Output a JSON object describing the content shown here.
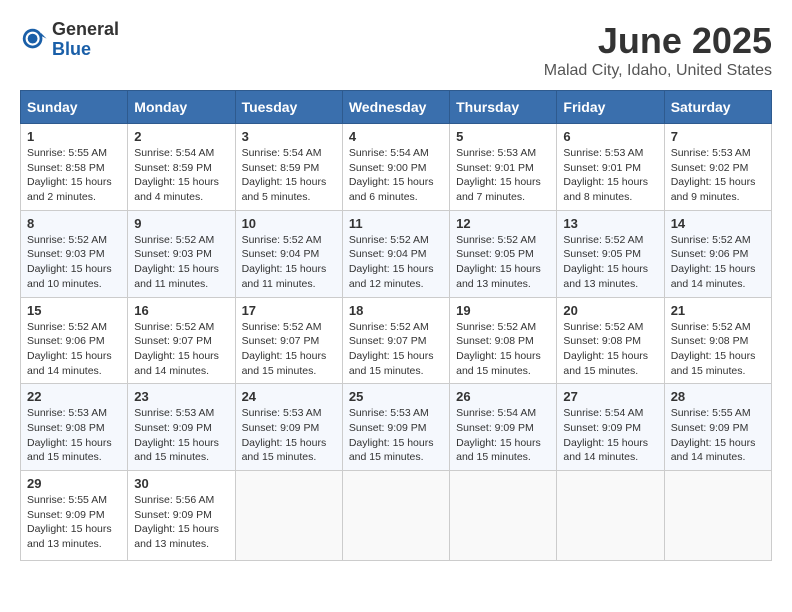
{
  "logo": {
    "general": "General",
    "blue": "Blue"
  },
  "title": "June 2025",
  "subtitle": "Malad City, Idaho, United States",
  "days_of_week": [
    "Sunday",
    "Monday",
    "Tuesday",
    "Wednesday",
    "Thursday",
    "Friday",
    "Saturday"
  ],
  "weeks": [
    [
      {
        "day": "1",
        "sunrise": "5:55 AM",
        "sunset": "8:58 PM",
        "daylight": "15 hours and 2 minutes."
      },
      {
        "day": "2",
        "sunrise": "5:54 AM",
        "sunset": "8:59 PM",
        "daylight": "15 hours and 4 minutes."
      },
      {
        "day": "3",
        "sunrise": "5:54 AM",
        "sunset": "8:59 PM",
        "daylight": "15 hours and 5 minutes."
      },
      {
        "day": "4",
        "sunrise": "5:54 AM",
        "sunset": "9:00 PM",
        "daylight": "15 hours and 6 minutes."
      },
      {
        "day": "5",
        "sunrise": "5:53 AM",
        "sunset": "9:01 PM",
        "daylight": "15 hours and 7 minutes."
      },
      {
        "day": "6",
        "sunrise": "5:53 AM",
        "sunset": "9:01 PM",
        "daylight": "15 hours and 8 minutes."
      },
      {
        "day": "7",
        "sunrise": "5:53 AM",
        "sunset": "9:02 PM",
        "daylight": "15 hours and 9 minutes."
      }
    ],
    [
      {
        "day": "8",
        "sunrise": "5:52 AM",
        "sunset": "9:03 PM",
        "daylight": "15 hours and 10 minutes."
      },
      {
        "day": "9",
        "sunrise": "5:52 AM",
        "sunset": "9:03 PM",
        "daylight": "15 hours and 11 minutes."
      },
      {
        "day": "10",
        "sunrise": "5:52 AM",
        "sunset": "9:04 PM",
        "daylight": "15 hours and 11 minutes."
      },
      {
        "day": "11",
        "sunrise": "5:52 AM",
        "sunset": "9:04 PM",
        "daylight": "15 hours and 12 minutes."
      },
      {
        "day": "12",
        "sunrise": "5:52 AM",
        "sunset": "9:05 PM",
        "daylight": "15 hours and 13 minutes."
      },
      {
        "day": "13",
        "sunrise": "5:52 AM",
        "sunset": "9:05 PM",
        "daylight": "15 hours and 13 minutes."
      },
      {
        "day": "14",
        "sunrise": "5:52 AM",
        "sunset": "9:06 PM",
        "daylight": "15 hours and 14 minutes."
      }
    ],
    [
      {
        "day": "15",
        "sunrise": "5:52 AM",
        "sunset": "9:06 PM",
        "daylight": "15 hours and 14 minutes."
      },
      {
        "day": "16",
        "sunrise": "5:52 AM",
        "sunset": "9:07 PM",
        "daylight": "15 hours and 14 minutes."
      },
      {
        "day": "17",
        "sunrise": "5:52 AM",
        "sunset": "9:07 PM",
        "daylight": "15 hours and 15 minutes."
      },
      {
        "day": "18",
        "sunrise": "5:52 AM",
        "sunset": "9:07 PM",
        "daylight": "15 hours and 15 minutes."
      },
      {
        "day": "19",
        "sunrise": "5:52 AM",
        "sunset": "9:08 PM",
        "daylight": "15 hours and 15 minutes."
      },
      {
        "day": "20",
        "sunrise": "5:52 AM",
        "sunset": "9:08 PM",
        "daylight": "15 hours and 15 minutes."
      },
      {
        "day": "21",
        "sunrise": "5:52 AM",
        "sunset": "9:08 PM",
        "daylight": "15 hours and 15 minutes."
      }
    ],
    [
      {
        "day": "22",
        "sunrise": "5:53 AM",
        "sunset": "9:08 PM",
        "daylight": "15 hours and 15 minutes."
      },
      {
        "day": "23",
        "sunrise": "5:53 AM",
        "sunset": "9:09 PM",
        "daylight": "15 hours and 15 minutes."
      },
      {
        "day": "24",
        "sunrise": "5:53 AM",
        "sunset": "9:09 PM",
        "daylight": "15 hours and 15 minutes."
      },
      {
        "day": "25",
        "sunrise": "5:53 AM",
        "sunset": "9:09 PM",
        "daylight": "15 hours and 15 minutes."
      },
      {
        "day": "26",
        "sunrise": "5:54 AM",
        "sunset": "9:09 PM",
        "daylight": "15 hours and 15 minutes."
      },
      {
        "day": "27",
        "sunrise": "5:54 AM",
        "sunset": "9:09 PM",
        "daylight": "15 hours and 14 minutes."
      },
      {
        "day": "28",
        "sunrise": "5:55 AM",
        "sunset": "9:09 PM",
        "daylight": "15 hours and 14 minutes."
      }
    ],
    [
      {
        "day": "29",
        "sunrise": "5:55 AM",
        "sunset": "9:09 PM",
        "daylight": "15 hours and 13 minutes."
      },
      {
        "day": "30",
        "sunrise": "5:56 AM",
        "sunset": "9:09 PM",
        "daylight": "15 hours and 13 minutes."
      },
      null,
      null,
      null,
      null,
      null
    ]
  ]
}
